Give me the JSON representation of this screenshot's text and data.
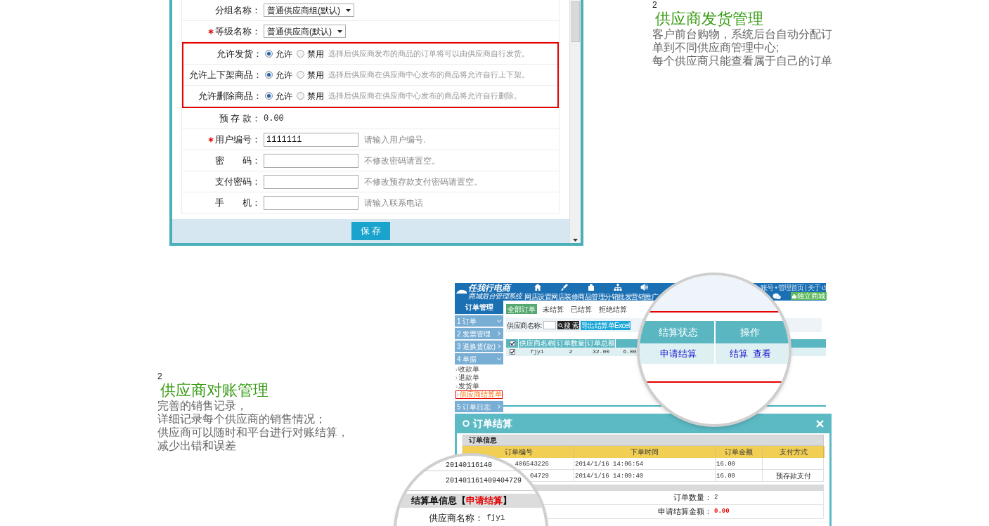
{
  "supplier_form": {
    "rows": [
      {
        "kind": "select",
        "label": "分组名称：",
        "required": false,
        "highlighted": false,
        "value": "普通供应商组(默认)"
      },
      {
        "kind": "select",
        "label": "等级名称：",
        "required": true,
        "highlighted": false,
        "value": "普通供应商(默认)"
      },
      {
        "kind": "radio",
        "label": "允许发货：",
        "required": false,
        "highlighted": true,
        "options": [
          {
            "label": "允许",
            "selected": true
          },
          {
            "label": "禁用",
            "selected": false
          }
        ],
        "hint": "选择后供应商发布的商品的订单将可以由供应商自行发货。"
      },
      {
        "kind": "radio",
        "label": "允许上下架商品：",
        "required": false,
        "highlighted": true,
        "options": [
          {
            "label": "允许",
            "selected": true
          },
          {
            "label": "禁用",
            "selected": false
          }
        ],
        "hint": "选择后供应商在供应商中心发布的商品将允许自行上下架。"
      },
      {
        "kind": "radio",
        "label": "允许删除商品：",
        "required": false,
        "highlighted": true,
        "options": [
          {
            "label": "允许",
            "selected": true
          },
          {
            "label": "禁用",
            "selected": false
          }
        ],
        "hint": "选择后供应商在供应商中心发布的商品将允许自行删除。"
      },
      {
        "kind": "text",
        "label": "预 存 款：",
        "required": false,
        "highlighted": false,
        "value": "0.00"
      },
      {
        "kind": "input",
        "label": "用户编号：",
        "required": true,
        "highlighted": false,
        "value": "1111111",
        "hint": "请输入用户编号."
      },
      {
        "kind": "input",
        "label": "密　　码：",
        "required": false,
        "highlighted": false,
        "hint": "不修改密码请置空。"
      },
      {
        "kind": "input",
        "label": "支付密码：",
        "required": false,
        "highlighted": false,
        "hint": "不修改预存款支付密码请置空。"
      },
      {
        "kind": "input",
        "label": "手　　机：",
        "required": false,
        "highlighted": false,
        "hint": "请输入联系电话"
      }
    ],
    "save_button": "保 存"
  },
  "features": [
    {
      "number": "2",
      "title": "供应商发货管理",
      "lines": [
        "客户前台购物，系统后台自动分配订",
        "单到不同供应商管理中心;",
        "每个供应商只能查看属于自己的订单"
      ]
    },
    {
      "number": "2",
      "title": "供应商对账管理",
      "lines": [
        "完善的销售记录，",
        "详细记录每个供应商的销售情况；",
        "供应商可以随时和平台进行对账结算，",
        "减少出错和误差"
      ]
    }
  ],
  "order_admin": {
    "logo": {
      "name": "任我行电商",
      "subtitle": "商城后台管理系统"
    },
    "nav": [
      "网店设置",
      "网店装修",
      "商品管理",
      "分销批发",
      "营销推广"
    ],
    "top_links": "账号 • 管理首页 | 关于",
    "store_button": "独立商城",
    "sidebar": {
      "title": "订单管理",
      "items": [
        {
          "label": "1 订单",
          "expanded": true
        },
        {
          "label": "2 发票管理",
          "expanded": false
        },
        {
          "label": "3 退换货(款)",
          "expanded": false
        },
        {
          "label": "4 单据",
          "expanded": true,
          "children": [
            {
              "label": "收款单",
              "selected": false
            },
            {
              "label": "退款单",
              "selected": false
            },
            {
              "label": "发货单",
              "selected": false
            },
            {
              "label": "供应商结算单",
              "selected": true
            }
          ]
        },
        {
          "label": "5 订单日志",
          "expanded": false
        }
      ]
    },
    "tabs": [
      {
        "label": "全部订单",
        "selected": true
      },
      {
        "label": "未结算",
        "selected": false
      },
      {
        "label": "已结算",
        "selected": false
      },
      {
        "label": "拒绝结算",
        "selected": false
      }
    ],
    "search": {
      "label": "供应商名称:",
      "button": "搜 索",
      "export_button": "导出结算单Excel"
    },
    "table": {
      "select_all_checked": true,
      "columns": [
        "供应商名称",
        "订单数量",
        "订单总额"
      ],
      "rows": [
        {
          "checked": true,
          "cells": [
            "fjy1",
            "2",
            "32.00",
            "6.00"
          ]
        }
      ]
    }
  },
  "magnifier_top": {
    "columns": [
      "结算状态",
      "操作"
    ],
    "status": "申请结算",
    "actions": [
      "结算",
      "查看"
    ]
  },
  "settlement_dialog": {
    "title": "订单结算",
    "section": "订单信息",
    "columns": [
      "订单编号",
      "下单时间",
      "订单金额",
      "支付方式"
    ],
    "rows": [
      {
        "order_no": "406543226",
        "time": "2014/1/16 14:06:54",
        "amount": "16.00"
      },
      {
        "order_no": "04729",
        "time": "2014/1/16 14:09:40",
        "amount": "16.00",
        "payment": "预存款支付"
      }
    ],
    "summary": [
      {
        "label": "订单数量：",
        "value": "2",
        "emphasis": false
      },
      {
        "label": "申请结算金额：",
        "value": "0.00",
        "emphasis": true
      }
    ]
  },
  "magnifier_bottom": {
    "order_numbers": [
      "20140116140",
      "201401161409404729"
    ],
    "heading": "结算单信息【",
    "status": "申请结算",
    "heading_end": "】",
    "supplier_label": "供应商名称：",
    "supplier_value": "fjy1"
  }
}
